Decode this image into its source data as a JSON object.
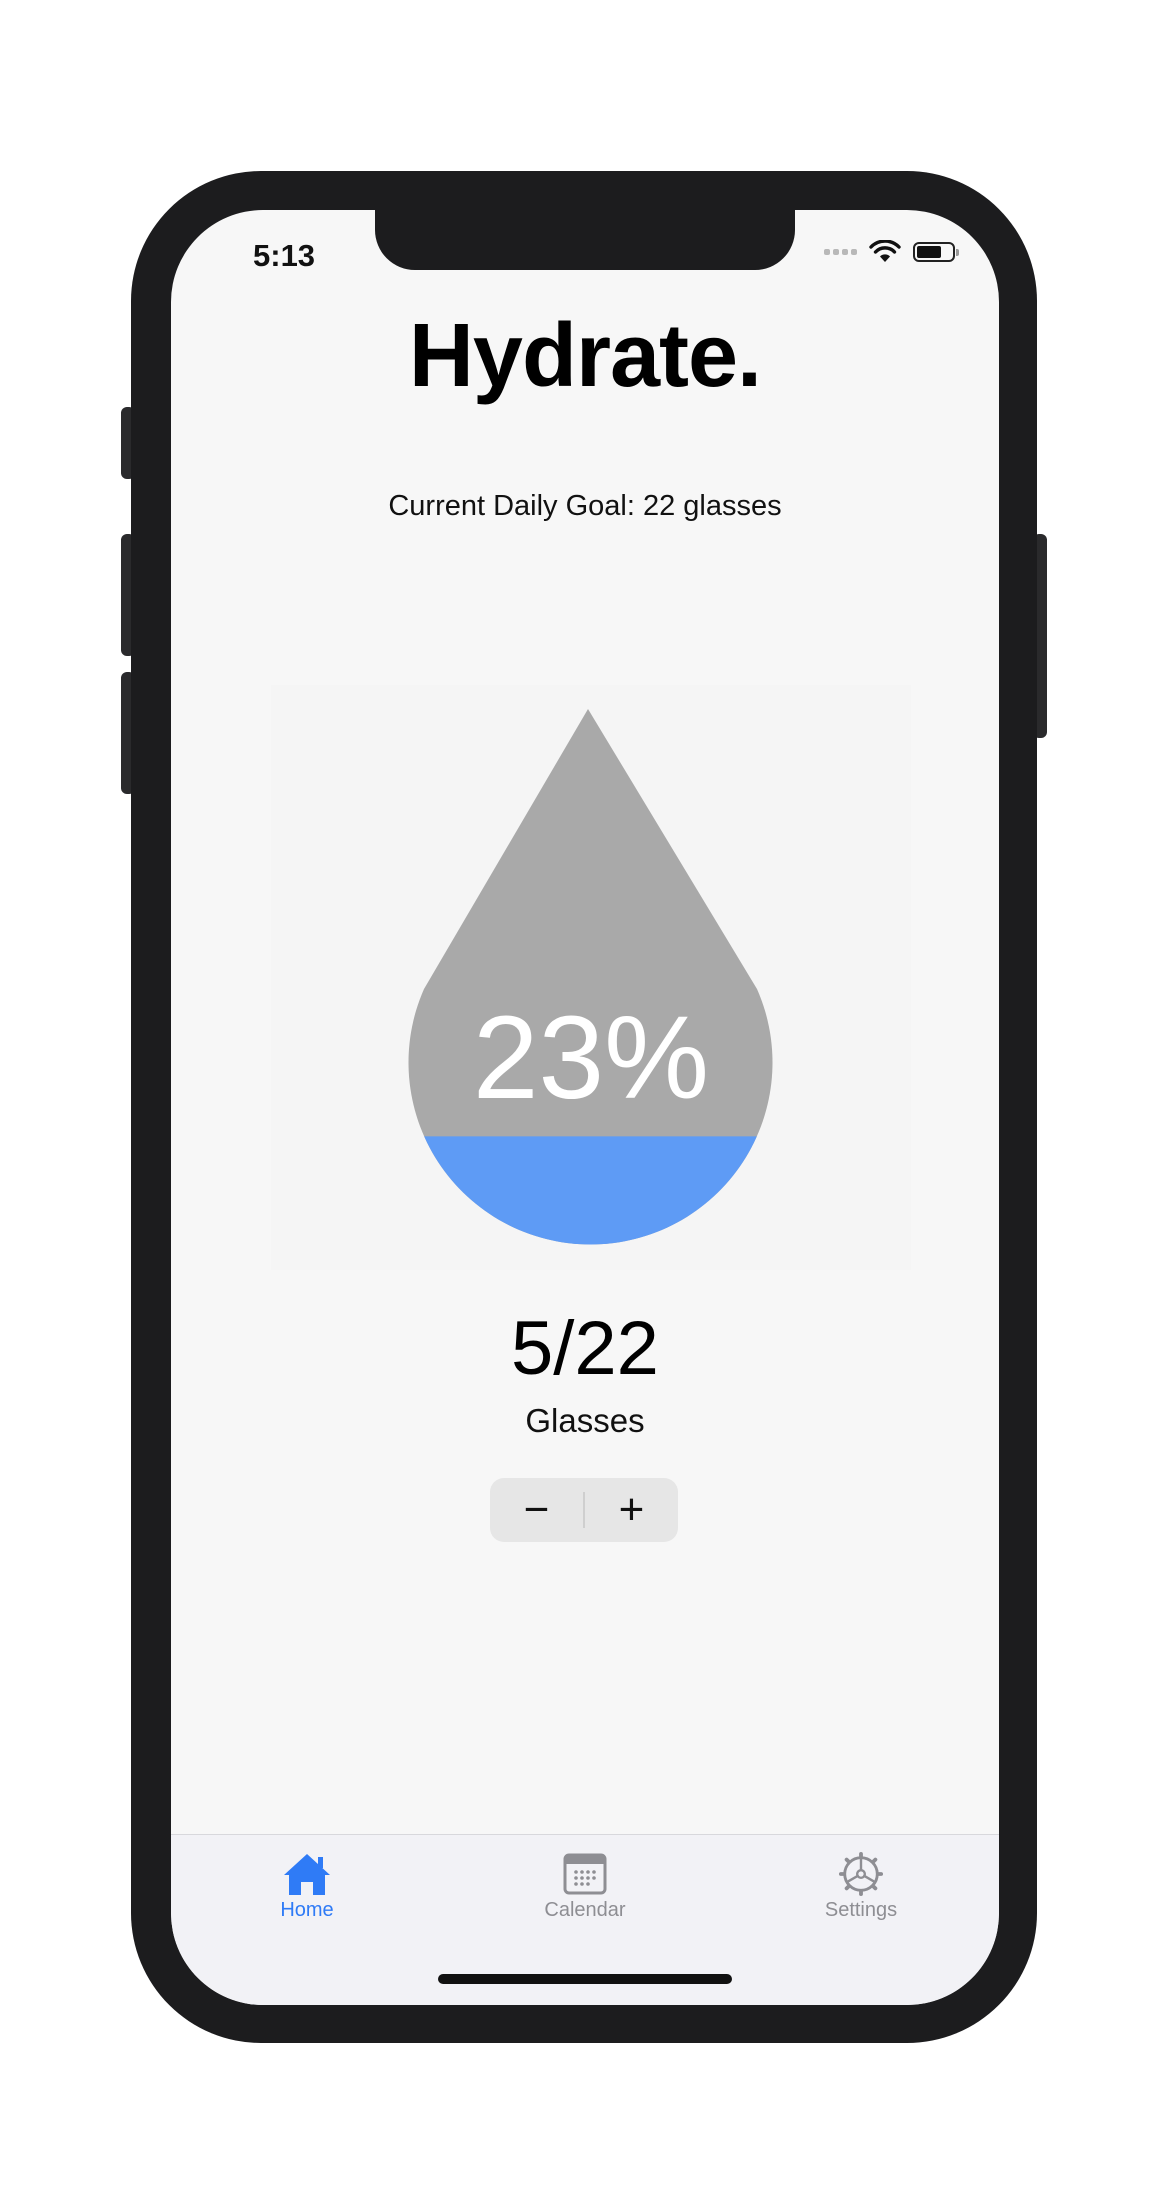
{
  "status_bar": {
    "time": "5:13"
  },
  "app": {
    "title": "Hydrate."
  },
  "goal": {
    "text": "Current Daily Goal: 22 glasses"
  },
  "progress": {
    "percent_label": "23%",
    "fill_fraction": 0.23,
    "count_label": "5/22",
    "unit_label": "Glasses"
  },
  "stepper": {
    "decrement": "−",
    "increment": "+"
  },
  "tabs": [
    {
      "label": "Home",
      "icon": "house-icon",
      "selected": true
    },
    {
      "label": "Calendar",
      "icon": "calendar-icon",
      "selected": false
    },
    {
      "label": "Settings",
      "icon": "gear-icon",
      "selected": false
    }
  ],
  "colors": {
    "accent": "#2f7bf6",
    "water": "#5e9bf5",
    "drop_empty": "#a9a9a9",
    "phone_frame": "#1c1c1e"
  }
}
